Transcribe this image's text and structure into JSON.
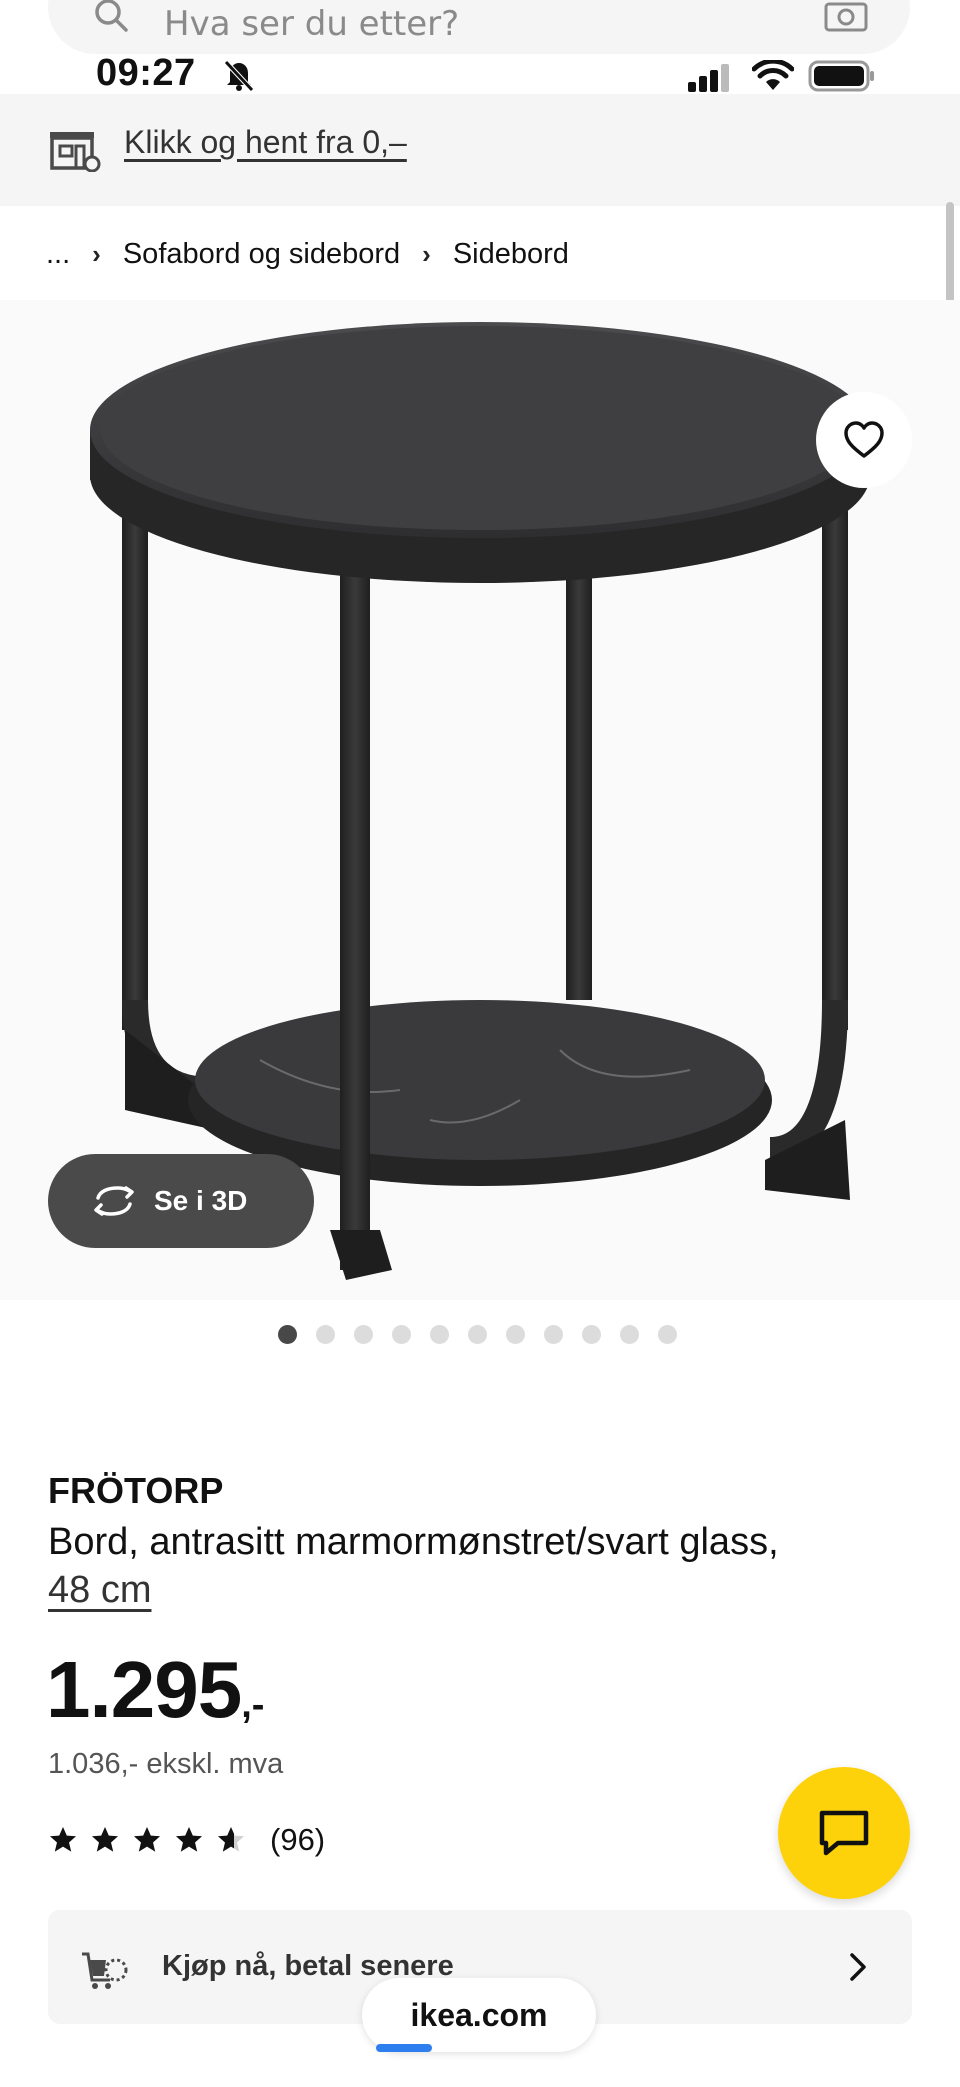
{
  "search": {
    "placeholder": "Hva ser du etter?"
  },
  "status_bar": {
    "time": "09:27"
  },
  "click_collect": {
    "text": "Klikk og hent fra 0,–"
  },
  "breadcrumb": {
    "ellipsis": "...",
    "items": [
      "Sofabord og sidebord",
      "Sidebord"
    ]
  },
  "gallery": {
    "see_3d": "Se i 3D",
    "image_count": 11,
    "active_index": 0
  },
  "product": {
    "name": "FRÖTORP",
    "description": "Bord, antrasitt marmormønstret/svart glass,",
    "size": "48 cm",
    "price": "1.295",
    "price_suffix": ",-",
    "price_ex_vat": "1.036,- ekskl. mva",
    "rating_value": 4.6,
    "rating_count": "(96)"
  },
  "payment": {
    "label": "Kjøp nå, betal senere"
  },
  "browser": {
    "url": "ikea.com"
  },
  "colors": {
    "chat_fab": "#fdd20a",
    "band_bg": "#f5f5f5",
    "indicator": "#2d7ff0"
  },
  "icons": [
    "search-icon",
    "camera-icon",
    "bell-slash-icon",
    "signal-icon",
    "wifi-icon",
    "battery-icon",
    "store-icon",
    "heart-icon",
    "rotate-3d-icon",
    "star-icon",
    "chat-icon",
    "cart-clock-icon",
    "chevron-right-icon"
  ]
}
